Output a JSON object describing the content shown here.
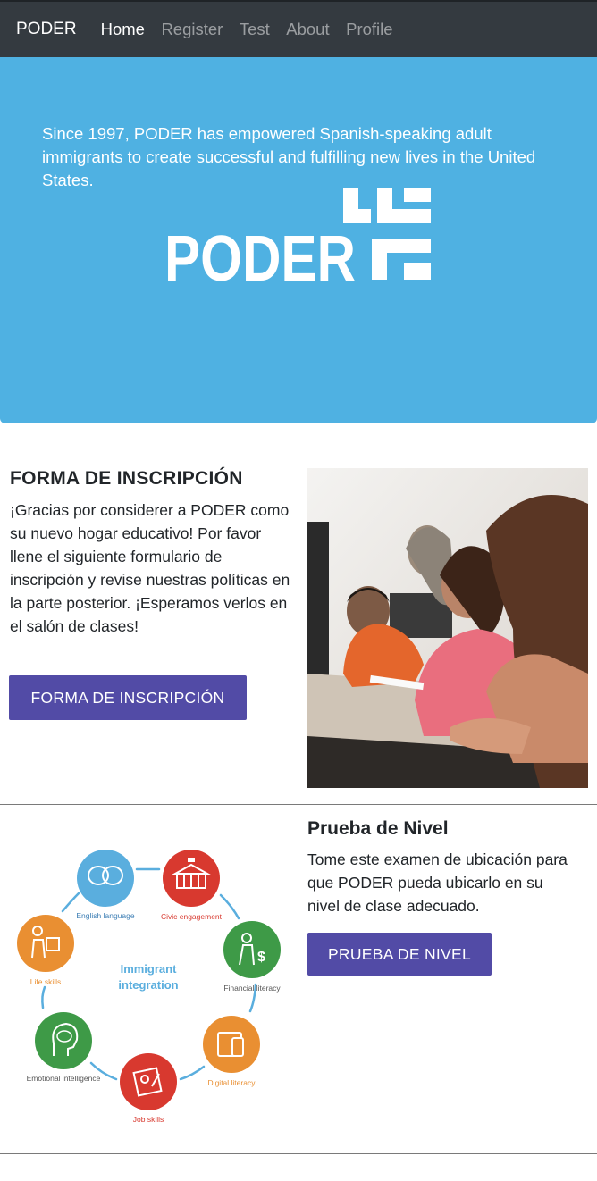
{
  "nav": {
    "brand": "PODER",
    "items": [
      {
        "label": "Home",
        "active": true
      },
      {
        "label": "Register",
        "active": false
      },
      {
        "label": "Test",
        "active": false
      },
      {
        "label": "About",
        "active": false
      },
      {
        "label": "Profile",
        "active": false
      }
    ]
  },
  "hero": {
    "text": "Since 1997, PODER has empowered Spanish-speaking adult immigrants to create successful and fulfilling new lives in the United States.",
    "logo_text": "PODER",
    "background": "#4fb1e2"
  },
  "registration": {
    "title": "FORMA DE INSCRIPCIÓN",
    "text": "¡Gracias por considerer a PODER como su nuevo hogar educativo! Por favor llene el siguiente formulario de inscripción y revise nuestras políticas en la parte posterior. ¡Esperamos verlos en el salón de clases!",
    "button_label": "FORMA DE INSCRIPCIÓN",
    "button_color": "#524ba6"
  },
  "placement": {
    "title": "Prueba de Nivel",
    "text": "Tome este examen de ubicación para que PODER pueda ubicarlo en su nivel de clase adecuado.",
    "button_label": "PRUEBA DE NIVEL"
  },
  "integration_wheel": {
    "center_line1": "Immigrant",
    "center_line2": "integration",
    "items": [
      {
        "label": "English language",
        "color": "#5aaede",
        "icon": "speech-bubbles-icon"
      },
      {
        "label": "Civic engagement",
        "color": "#d8392f",
        "icon": "capitol-building-icon"
      },
      {
        "label": "Financial literacy",
        "color": "#3e9a47",
        "icon": "money-person-icon"
      },
      {
        "label": "Digital literacy",
        "color": "#e98f32",
        "icon": "devices-icon"
      },
      {
        "label": "Job skills",
        "color": "#d8392f",
        "icon": "resume-icon"
      },
      {
        "label": "Emotional intelligence",
        "color": "#3e9a47",
        "icon": "head-chat-icon"
      },
      {
        "label": "Life skills",
        "color": "#e98f32",
        "icon": "puzzle-person-icon"
      }
    ]
  }
}
